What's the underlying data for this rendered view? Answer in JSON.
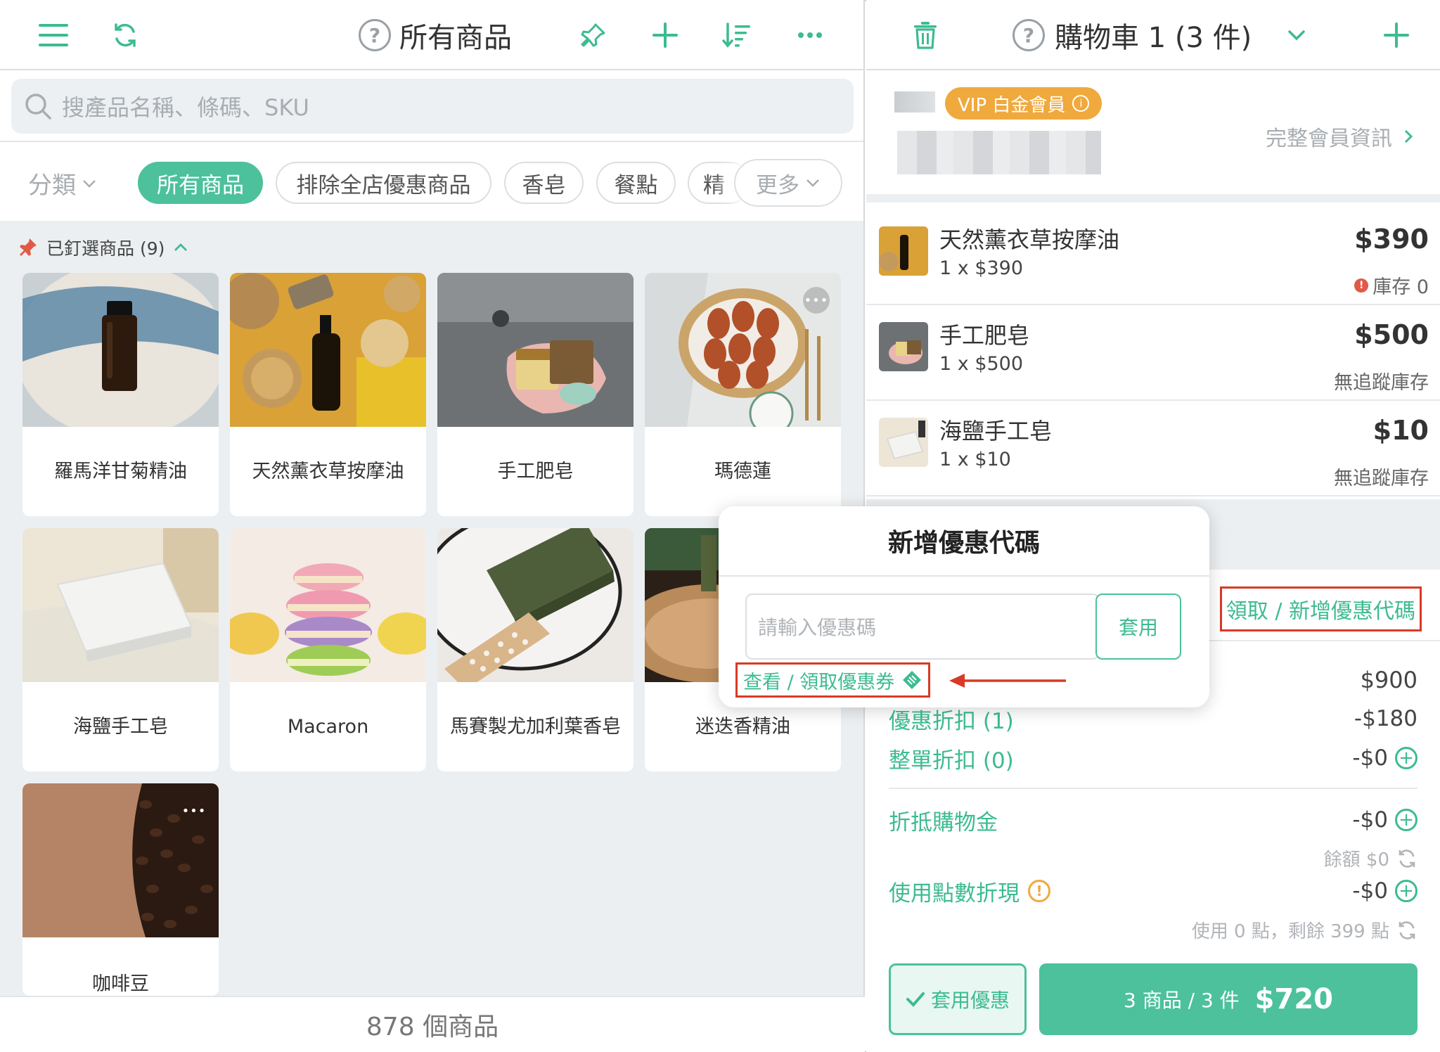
{
  "left": {
    "title": "所有商品",
    "search_placeholder": "搜產品名稱、條碼、SKU",
    "category_label": "分類",
    "chips": [
      "所有商品",
      "排除全店優惠商品",
      "香皂",
      "餐點",
      "精"
    ],
    "more_label": "更多",
    "pinned_label": "已釘選商品 (9)",
    "products": [
      "羅馬洋甘菊精油",
      "天然薰衣草按摩油",
      "手工肥皂",
      "瑪德蓮",
      "海鹽手工皂",
      "Macaron",
      "馬賽製尤加利葉香皂",
      "迷迭香精油",
      "咖啡豆"
    ],
    "footer_count": "878 個商品"
  },
  "right": {
    "cart_title": "購物車 1 (3 件)",
    "vip_label": "VIP 白金會員",
    "member_link": "完整會員資訊",
    "items": [
      {
        "name": "天然薰衣草按摩油",
        "qty": "1 x $390",
        "price": "$390",
        "stock": "庫存 0"
      },
      {
        "name": "手工肥皂",
        "qty": "1 x $500",
        "price": "$500",
        "stock": "無追蹤庫存"
      },
      {
        "name": "海鹽手工皂",
        "qty": "1 x $10",
        "price": "$10",
        "stock": "無追蹤庫存"
      }
    ],
    "coupon_link": "領取 / 新增優惠代碼",
    "subtotal": "$900",
    "discount_label": "優惠折扣 (1)",
    "discount_value": "-$180",
    "order_discount_label": "整單折扣 (0)",
    "order_discount_value": "-$0",
    "credit_label": "折抵購物金",
    "credit_value": "-$0",
    "credit_balance": "餘額 $0",
    "points_label": "使用點數折現",
    "points_value": "-$0",
    "points_note": "使用 0 點，剩餘 399 點",
    "apply_discount": "套用優惠",
    "checkout_summary": "3 商品 / 3 件",
    "checkout_total": "$720"
  },
  "popup": {
    "title": "新增優惠代碼",
    "input_placeholder": "請輸入優惠碼",
    "apply_label": "套用",
    "view_coupons": "查看 / 領取優惠券"
  },
  "colors": {
    "accent": "#4cc19b",
    "vip": "#f0a93d",
    "highlight": "#d93a26"
  }
}
